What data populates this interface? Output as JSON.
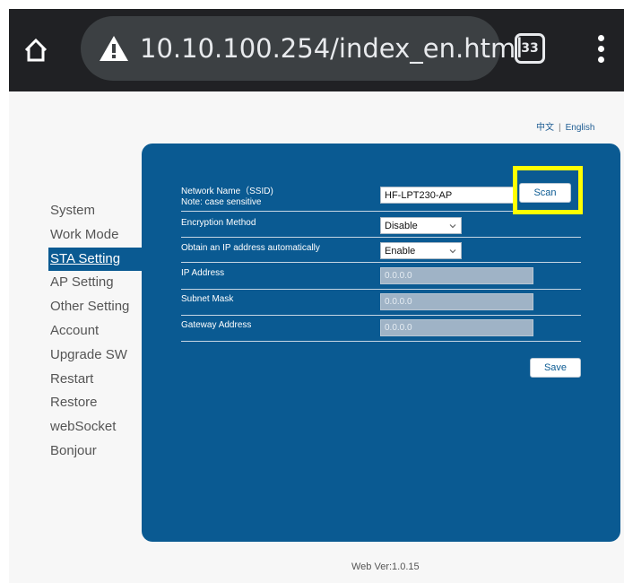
{
  "browser": {
    "url": "10.10.100.254/index_en.html",
    "tab_count": "33",
    "icons": {
      "home": "home-icon",
      "warning": "warning-triangle-icon",
      "tabs": "tabs-counter-icon",
      "menu": "more-vert-icon"
    }
  },
  "language": {
    "chinese": "中文",
    "separator": "|",
    "english": "English"
  },
  "sidebar": {
    "items": [
      {
        "label": "System",
        "active": false
      },
      {
        "label": "Work Mode",
        "active": false
      },
      {
        "label": "STA Setting",
        "active": true
      },
      {
        "label": "AP Setting",
        "active": false
      },
      {
        "label": "Other Setting",
        "active": false
      },
      {
        "label": "Account",
        "active": false
      },
      {
        "label": "Upgrade SW",
        "active": false
      },
      {
        "label": "Restart",
        "active": false
      },
      {
        "label": "Restore",
        "active": false
      },
      {
        "label": "webSocket",
        "active": false
      },
      {
        "label": "Bonjour",
        "active": false
      }
    ]
  },
  "form": {
    "ssid": {
      "label": "Network Name（SSID)",
      "note": "Note: case sensitive",
      "value": "HF-LPT230-AP"
    },
    "scan_label": "Scan",
    "encryption": {
      "label": "Encryption Method",
      "value": "Disable"
    },
    "dhcp": {
      "label": "Obtain an IP address automatically",
      "value": "Enable"
    },
    "ip": {
      "label": "IP Address",
      "value": "0.0.0.0"
    },
    "subnet": {
      "label": "Subnet Mask",
      "value": "0.0.0.0"
    },
    "gateway": {
      "label": "Gateway Address",
      "value": "0.0.0.0"
    },
    "save_label": "Save"
  },
  "footer": {
    "version": "Web Ver:1.0.15"
  },
  "colors": {
    "panel": "#0a5a92",
    "highlight": "#ffff00",
    "browser_bar": "#202124"
  }
}
